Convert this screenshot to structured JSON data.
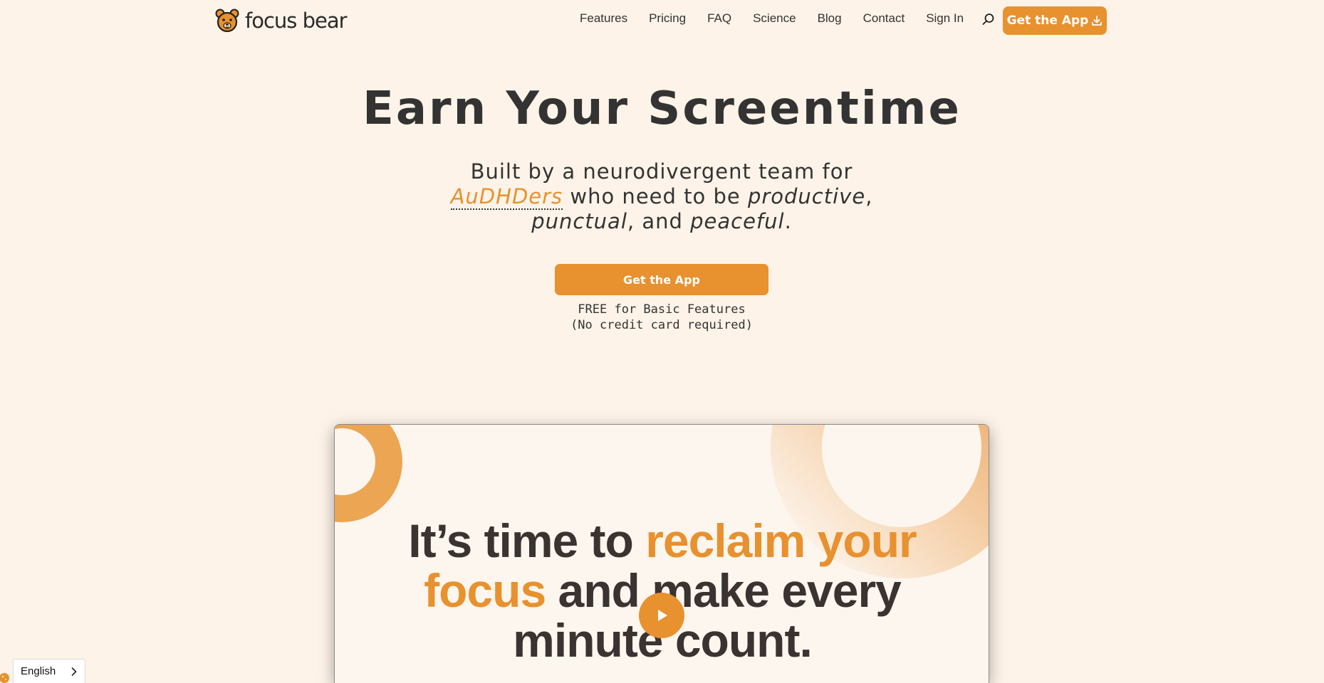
{
  "header": {
    "logo_text": "focus bear",
    "nav": [
      "Features",
      "Pricing",
      "FAQ",
      "Science",
      "Blog",
      "Contact",
      "Sign In"
    ],
    "search_icon": "search-icon",
    "cta_label": "Get the App",
    "cta_icon": "download-icon"
  },
  "hero": {
    "title": "Earn Your Screentime",
    "subtitle_line1": "Built by a neurodivergent team for",
    "highlight": "AuDHDers",
    "subtitle_mid": " who need to be ",
    "word_productive": "productive",
    "comma1": ",",
    "word_punctual": "punctual",
    "and_text": ", and ",
    "word_peaceful": "peaceful",
    "period": ".",
    "cta_label": "Get the App",
    "free_line1": "FREE for Basic Features",
    "free_line2": "(No credit card required)"
  },
  "video": {
    "text_a": "It’s time to ",
    "text_b": "reclaim your focus",
    "text_c": " and make every minute count.",
    "play_icon": "play-icon"
  },
  "language": {
    "label": "English",
    "chevron_icon": "chevron-right-icon"
  },
  "colors": {
    "background": "#fdf3e8",
    "accent": "#e8912f",
    "text": "#333333"
  }
}
